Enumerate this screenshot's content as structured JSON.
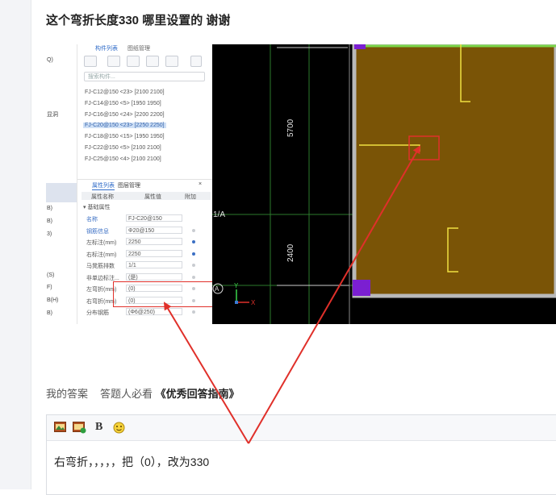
{
  "question": {
    "title": "这个弯折长度330 哪里设置的 谢谢"
  },
  "screenshot": {
    "left_labels": [
      "Q)",
      "显洞",
      "B)",
      "B)",
      "3)",
      "(S)",
      "F)",
      "B(H)",
      "B)"
    ],
    "panel": {
      "header_text": "构件列表",
      "header_text2": "图纸管理",
      "search_placeholder": "搜索构件...",
      "components": [
        "FJ-C12@150 <23> [2100 2100]",
        "FJ-C14@150 <5> [1950 1950]",
        "FJ-C16@150 <24> [2200 2200]",
        "FJ-C20@150 <23> [2250 2250]",
        "FJ-C18@150 <15> [1950 1950]",
        "FJ-C22@150 <5> [2100 2100]",
        "FJ-C25@150 <4> [2100 2100]"
      ],
      "selected_component": 3,
      "tab_properties": "属性列表",
      "tab_layers": "图层管理",
      "col_name": "属性名称",
      "col_value": "属性值",
      "col_attach": "附加",
      "group_label": "基础属性",
      "properties": [
        {
          "name": "名称",
          "value": "FJ-C20@150",
          "blue": true,
          "dot": "none"
        },
        {
          "name": "钢筋信息",
          "value": "Φ20@150",
          "blue": true,
          "dot": "grey"
        },
        {
          "name": "左标注(mm)",
          "value": "2250",
          "blue": false,
          "dot": "blue"
        },
        {
          "name": "右标注(mm)",
          "value": "2250",
          "blue": false,
          "dot": "blue"
        },
        {
          "name": "马凳筋排数",
          "value": "1/1",
          "blue": false,
          "dot": "grey"
        },
        {
          "name": "非单边标注...",
          "value": "(是)",
          "blue": false,
          "dot": "grey"
        },
        {
          "name": "左弯折(mm)",
          "value": "(0)",
          "blue": false,
          "dot": "grey"
        },
        {
          "name": "右弯折(mm)",
          "value": "(0)",
          "blue": false,
          "dot": "grey"
        },
        {
          "name": "分布钢筋",
          "value": "(Φ6@250)",
          "blue": false,
          "dot": "grey"
        }
      ]
    },
    "cad": {
      "dim_top": "5700",
      "dim_bottom": "2400",
      "grid_label": "1/A",
      "axis_circle": "A",
      "axis_y": "Y",
      "axis_x": "X"
    }
  },
  "answer": {
    "tab_my_answer": "我的答案",
    "tab_must_read": "答题人必看",
    "guide_link": "《优秀回答指南》",
    "editor_bold": "B",
    "editor_text": "右弯折，，，，，把（0），改为330"
  },
  "colors": {
    "annotation_red": "#e0302a",
    "slab_fill": "#7a5406",
    "cad_bg": "#000000",
    "rebar_yellow": "#f0e040"
  }
}
